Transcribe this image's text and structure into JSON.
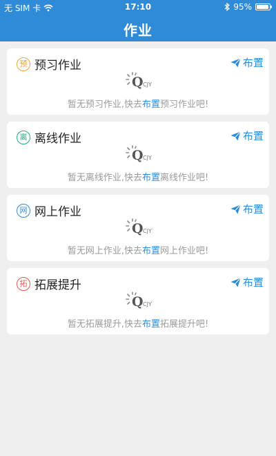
{
  "status": {
    "carrier": "无 SIM 卡",
    "time": "17:10",
    "battery": "95%",
    "battery_level": 0.95
  },
  "nav": {
    "title": "作业"
  },
  "cards": [
    {
      "badge": "预",
      "badge_color": "#f0a23b",
      "title": "预习作业",
      "action": "布置",
      "empty_prefix": "暂无预习作业,快去",
      "empty_link": "布置",
      "empty_suffix": "预习作业吧!"
    },
    {
      "badge": "离",
      "badge_color": "#22a884",
      "title": "离线作业",
      "action": "布置",
      "empty_prefix": "暂无离线作业,快去",
      "empty_link": "布置",
      "empty_suffix": "离线作业吧!"
    },
    {
      "badge": "网",
      "badge_color": "#2f8bd8",
      "title": "网上作业",
      "action": "布置",
      "empty_prefix": "暂无网上作业,快去",
      "empty_link": "布置",
      "empty_suffix": "网上作业吧!"
    },
    {
      "badge": "拓",
      "badge_color": "#e4554e",
      "title": "拓展提升",
      "action": "布置",
      "empty_prefix": "暂无拓展提升,快去",
      "empty_link": "布置",
      "empty_suffix": "拓展提升吧!"
    }
  ],
  "logo_text": "CJY",
  "icons": {
    "signal": "wifi-icon",
    "bluetooth": "bluetooth-icon",
    "battery": "battery-icon",
    "assign": "paper-plane-icon",
    "logo": "qcjy-logo-icon"
  }
}
